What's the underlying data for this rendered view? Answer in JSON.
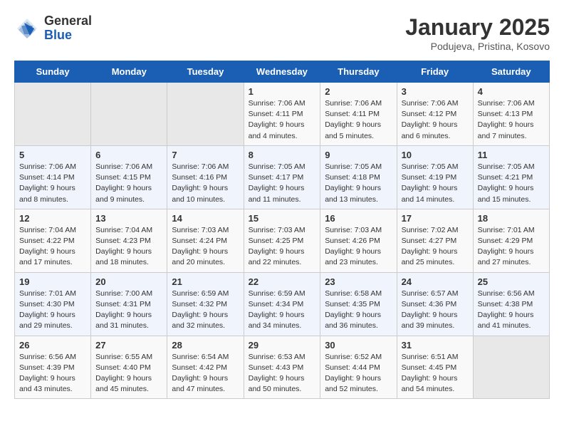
{
  "logo": {
    "general": "General",
    "blue": "Blue"
  },
  "header": {
    "month": "January 2025",
    "location": "Podujeva, Pristina, Kosovo"
  },
  "weekdays": [
    "Sunday",
    "Monday",
    "Tuesday",
    "Wednesday",
    "Thursday",
    "Friday",
    "Saturday"
  ],
  "weeks": [
    [
      {
        "day": "",
        "info": ""
      },
      {
        "day": "",
        "info": ""
      },
      {
        "day": "",
        "info": ""
      },
      {
        "day": "1",
        "info": "Sunrise: 7:06 AM\nSunset: 4:11 PM\nDaylight: 9 hours\nand 4 minutes."
      },
      {
        "day": "2",
        "info": "Sunrise: 7:06 AM\nSunset: 4:11 PM\nDaylight: 9 hours\nand 5 minutes."
      },
      {
        "day": "3",
        "info": "Sunrise: 7:06 AM\nSunset: 4:12 PM\nDaylight: 9 hours\nand 6 minutes."
      },
      {
        "day": "4",
        "info": "Sunrise: 7:06 AM\nSunset: 4:13 PM\nDaylight: 9 hours\nand 7 minutes."
      }
    ],
    [
      {
        "day": "5",
        "info": "Sunrise: 7:06 AM\nSunset: 4:14 PM\nDaylight: 9 hours\nand 8 minutes."
      },
      {
        "day": "6",
        "info": "Sunrise: 7:06 AM\nSunset: 4:15 PM\nDaylight: 9 hours\nand 9 minutes."
      },
      {
        "day": "7",
        "info": "Sunrise: 7:06 AM\nSunset: 4:16 PM\nDaylight: 9 hours\nand 10 minutes."
      },
      {
        "day": "8",
        "info": "Sunrise: 7:05 AM\nSunset: 4:17 PM\nDaylight: 9 hours\nand 11 minutes."
      },
      {
        "day": "9",
        "info": "Sunrise: 7:05 AM\nSunset: 4:18 PM\nDaylight: 9 hours\nand 13 minutes."
      },
      {
        "day": "10",
        "info": "Sunrise: 7:05 AM\nSunset: 4:19 PM\nDaylight: 9 hours\nand 14 minutes."
      },
      {
        "day": "11",
        "info": "Sunrise: 7:05 AM\nSunset: 4:21 PM\nDaylight: 9 hours\nand 15 minutes."
      }
    ],
    [
      {
        "day": "12",
        "info": "Sunrise: 7:04 AM\nSunset: 4:22 PM\nDaylight: 9 hours\nand 17 minutes."
      },
      {
        "day": "13",
        "info": "Sunrise: 7:04 AM\nSunset: 4:23 PM\nDaylight: 9 hours\nand 18 minutes."
      },
      {
        "day": "14",
        "info": "Sunrise: 7:03 AM\nSunset: 4:24 PM\nDaylight: 9 hours\nand 20 minutes."
      },
      {
        "day": "15",
        "info": "Sunrise: 7:03 AM\nSunset: 4:25 PM\nDaylight: 9 hours\nand 22 minutes."
      },
      {
        "day": "16",
        "info": "Sunrise: 7:03 AM\nSunset: 4:26 PM\nDaylight: 9 hours\nand 23 minutes."
      },
      {
        "day": "17",
        "info": "Sunrise: 7:02 AM\nSunset: 4:27 PM\nDaylight: 9 hours\nand 25 minutes."
      },
      {
        "day": "18",
        "info": "Sunrise: 7:01 AM\nSunset: 4:29 PM\nDaylight: 9 hours\nand 27 minutes."
      }
    ],
    [
      {
        "day": "19",
        "info": "Sunrise: 7:01 AM\nSunset: 4:30 PM\nDaylight: 9 hours\nand 29 minutes."
      },
      {
        "day": "20",
        "info": "Sunrise: 7:00 AM\nSunset: 4:31 PM\nDaylight: 9 hours\nand 31 minutes."
      },
      {
        "day": "21",
        "info": "Sunrise: 6:59 AM\nSunset: 4:32 PM\nDaylight: 9 hours\nand 32 minutes."
      },
      {
        "day": "22",
        "info": "Sunrise: 6:59 AM\nSunset: 4:34 PM\nDaylight: 9 hours\nand 34 minutes."
      },
      {
        "day": "23",
        "info": "Sunrise: 6:58 AM\nSunset: 4:35 PM\nDaylight: 9 hours\nand 36 minutes."
      },
      {
        "day": "24",
        "info": "Sunrise: 6:57 AM\nSunset: 4:36 PM\nDaylight: 9 hours\nand 39 minutes."
      },
      {
        "day": "25",
        "info": "Sunrise: 6:56 AM\nSunset: 4:38 PM\nDaylight: 9 hours\nand 41 minutes."
      }
    ],
    [
      {
        "day": "26",
        "info": "Sunrise: 6:56 AM\nSunset: 4:39 PM\nDaylight: 9 hours\nand 43 minutes."
      },
      {
        "day": "27",
        "info": "Sunrise: 6:55 AM\nSunset: 4:40 PM\nDaylight: 9 hours\nand 45 minutes."
      },
      {
        "day": "28",
        "info": "Sunrise: 6:54 AM\nSunset: 4:42 PM\nDaylight: 9 hours\nand 47 minutes."
      },
      {
        "day": "29",
        "info": "Sunrise: 6:53 AM\nSunset: 4:43 PM\nDaylight: 9 hours\nand 50 minutes."
      },
      {
        "day": "30",
        "info": "Sunrise: 6:52 AM\nSunset: 4:44 PM\nDaylight: 9 hours\nand 52 minutes."
      },
      {
        "day": "31",
        "info": "Sunrise: 6:51 AM\nSunset: 4:45 PM\nDaylight: 9 hours\nand 54 minutes."
      },
      {
        "day": "",
        "info": ""
      }
    ]
  ]
}
